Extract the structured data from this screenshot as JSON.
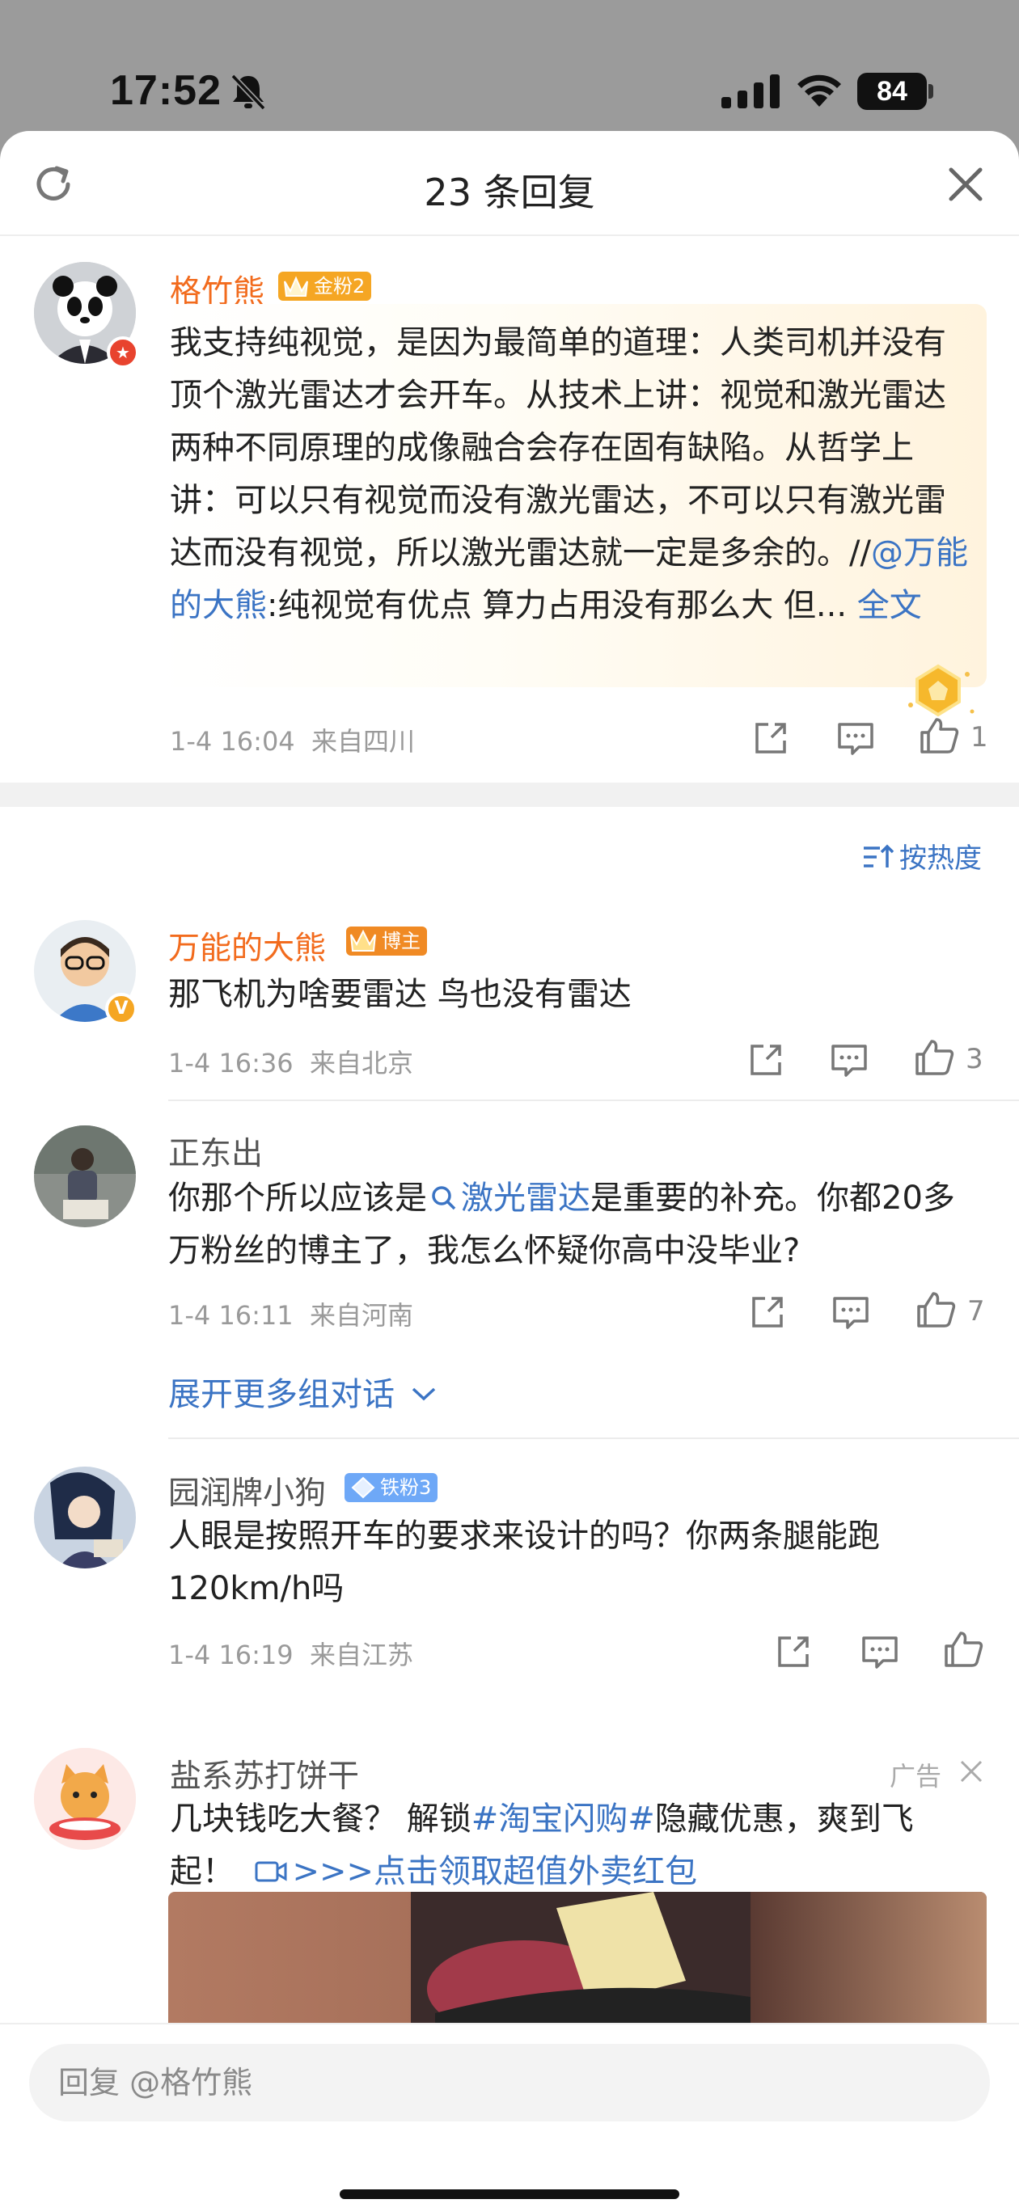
{
  "status_bar": {
    "time": "17:52",
    "battery": "84"
  },
  "header": {
    "title": "23 条回复"
  },
  "main_comment": {
    "author": "格竹熊",
    "fan_badge": "金粉2",
    "text_before_mention": "我支持纯视觉，是因为最简单的道理：人类司机并没有顶个激光雷达才会开车。从技术上讲：视觉和激光雷达两种不同原理的成像融合会存在固有缺陷。从哲学上讲：可以只有视觉而没有激光雷达，不可以只有激光雷达而没有视觉，所以激光雷达就一定是多余的。//",
    "mention": "@万能的大熊",
    "text_after_mention": ":纯视觉有优点 算力占用没有那么大 但...",
    "full_text_link": "全文",
    "time": "1-4 16:04",
    "location": "来自四川",
    "likes": "1"
  },
  "sort_label": "按热度",
  "replies": [
    {
      "author": "万能的大熊",
      "tag": "博主",
      "text": "那飞机为啥要雷达 鸟也没有雷达",
      "time": "1-4 16:36",
      "location": "来自北京",
      "likes": "3"
    },
    {
      "author": "正东出",
      "text_a": "你那个所以应该是",
      "topic": "激光雷达",
      "text_b": "是重要的补充。你都20多万粉丝的博主了，我怎么怀疑你高中没毕业?",
      "time": "1-4 16:11",
      "location": "来自河南",
      "likes": "7",
      "expand": "展开更多组对话"
    },
    {
      "author": "园润牌小狗",
      "tag": "铁粉3",
      "text": "人眼是按照开车的要求来设计的吗？你两条腿能跑120km/h吗",
      "time": "1-4 16:19",
      "location": "来自江苏",
      "likes": ""
    }
  ],
  "ad": {
    "author": "盐系苏打饼干",
    "label": "广告",
    "text_a": "几块钱吃大餐？ 解锁",
    "hashtag": "#淘宝闪购#",
    "text_b": "隐藏优惠，爽到飞起！",
    "cta": ">>>点击领取超值外卖红包"
  },
  "reply_placeholder": "回复 @格竹熊",
  "colors": {
    "accent_orange": "#f26b1d",
    "link_blue": "#3b74c4",
    "gold_badge": "#f5a623",
    "blogger_badge": "#f08a24",
    "iron_badge": "#6ea8f7"
  }
}
